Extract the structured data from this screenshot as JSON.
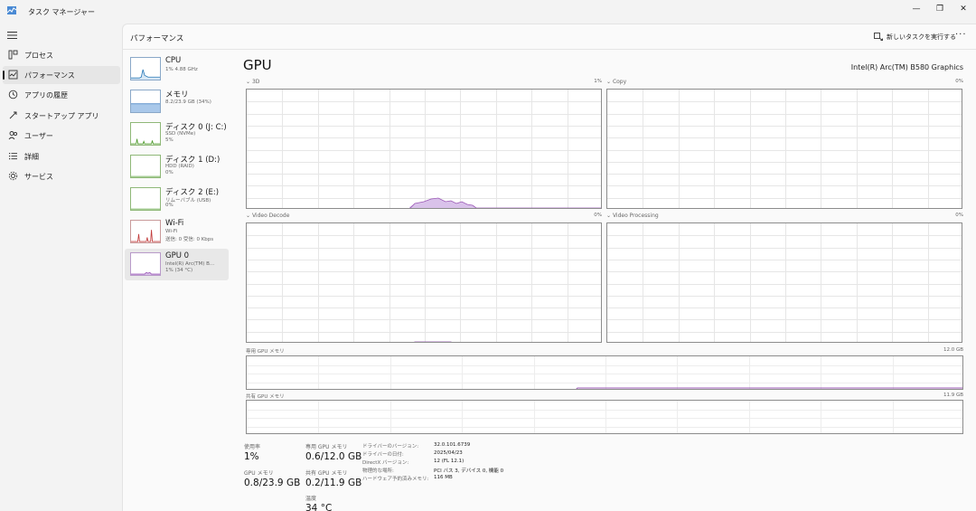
{
  "window": {
    "title": "タスク マネージャー",
    "controls": {
      "minimize": "—",
      "restore": "❐",
      "close": "✕"
    }
  },
  "nav": {
    "items": [
      {
        "label": "プロセス",
        "icon": "process-icon"
      },
      {
        "label": "パフォーマンス",
        "icon": "performance-icon",
        "active": true
      },
      {
        "label": "アプリの履歴",
        "icon": "history-icon"
      },
      {
        "label": "スタートアップ アプリ",
        "icon": "startup-icon"
      },
      {
        "label": "ユーザー",
        "icon": "users-icon"
      },
      {
        "label": "詳細",
        "icon": "details-icon"
      },
      {
        "label": "サービス",
        "icon": "services-icon"
      }
    ]
  },
  "header": {
    "title": "パフォーマンス",
    "run_task": "新しいタスクを実行する",
    "more": "···"
  },
  "devices": [
    {
      "name": "CPU",
      "sub1": "1% 4.88 GHz"
    },
    {
      "name": "メモリ",
      "sub1": "8.2/23.9 GB (34%)"
    },
    {
      "name": "ディスク 0 (J: C:)",
      "sub1": "SSD (NVMe)",
      "sub2": "5%"
    },
    {
      "name": "ディスク 1 (D:)",
      "sub1": "HDD (RAID)",
      "sub2": "0%"
    },
    {
      "name": "ディスク 2 (E:)",
      "sub1": "リムーバブル (USB)",
      "sub2": "0%"
    },
    {
      "name": "Wi-Fi",
      "sub1": "Wi-Fi",
      "sub2": "送信: 0 受信: 0 Kbps"
    },
    {
      "name": "GPU 0",
      "sub1": "Intel(R) Arc(TM) B...",
      "sub2": "1% (34 °C)",
      "selected": true
    }
  ],
  "detail": {
    "title": "GPU",
    "model": "Intel(R) Arc(TM) B580 Graphics",
    "engines": [
      {
        "name": "3D",
        "pct": "1%"
      },
      {
        "name": "Copy",
        "pct": "0%"
      },
      {
        "name": "Video Decode",
        "pct": "0%"
      },
      {
        "name": "Video Processing",
        "pct": "0%"
      }
    ],
    "dedicated_memory": {
      "label": "専用 GPU メモリ",
      "max": "12.0 GB"
    },
    "shared_memory": {
      "label": "共有 GPU メモリ",
      "max": "11.9 GB"
    }
  },
  "stats": {
    "utilization_label": "使用率",
    "utilization_value": "1%",
    "gpu_memory_label": "GPU メモリ",
    "gpu_memory_value": "0.8/23.9 GB",
    "dedicated_label": "専用 GPU メモリ",
    "dedicated_value": "0.6/12.0 GB",
    "shared_label": "共有 GPU メモリ",
    "shared_value": "0.2/11.9 GB",
    "temp_label": "温度",
    "temp_value": "34 °C",
    "info": [
      {
        "key": "ドライバーのバージョン:",
        "value": "32.0.101.6739"
      },
      {
        "key": "ドライバーの日付:",
        "value": "2025/04/23"
      },
      {
        "key": "DirectX バージョン:",
        "value": "12 (FL 12.1)"
      },
      {
        "key": "物理的な場所:",
        "value": "PCI バス 3, デバイス 0, 機能 0"
      },
      {
        "key": "ハードウェア予約済みメモリ:",
        "value": "116 MB"
      }
    ]
  },
  "colors": {
    "gpu_line": "#9b59b6",
    "gpu_fill": "#d9c2ea",
    "cpu_line": "#2a7ab8",
    "memory_fill": "#a9c8ea",
    "disk_line": "#4c9a2a",
    "wifi_line": "#c23b3b"
  }
}
